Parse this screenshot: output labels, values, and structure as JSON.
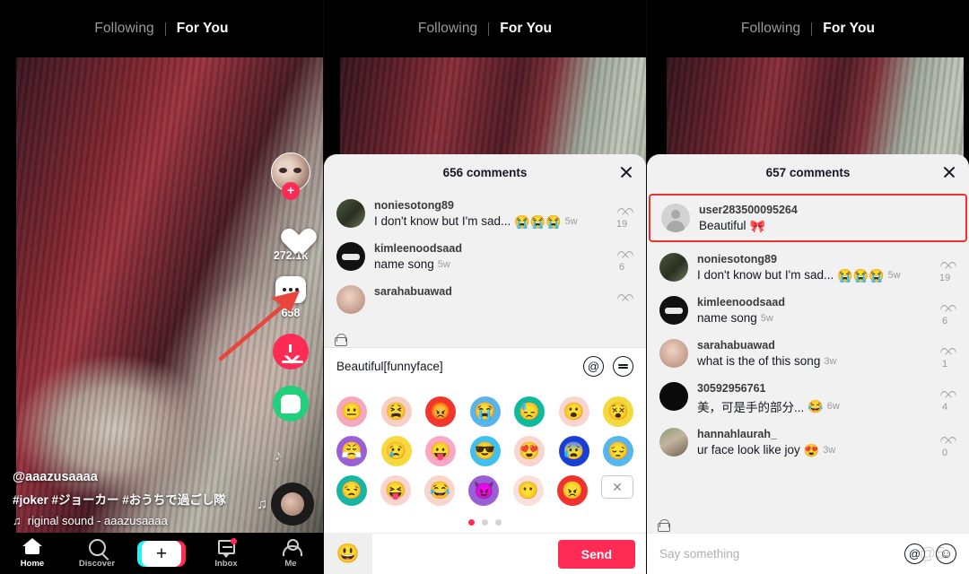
{
  "header": {
    "following_label": "Following",
    "for_you_label": "For You"
  },
  "panel1": {
    "rail": {
      "like_count": "272.1k",
      "comment_count": "658",
      "avatar_plus": "+"
    },
    "caption": {
      "username": "@aaazusaaaa",
      "hashtags": "#joker #ジョーカー #おうちで過ごし隊",
      "sound": "riginal sound - aaazusaaaa",
      "music_note": "♫"
    },
    "nav": [
      {
        "label": "Home",
        "icon": "home-icon"
      },
      {
        "label": "Discover",
        "icon": "search-icon"
      },
      {
        "label": "",
        "icon": "plus-icon"
      },
      {
        "label": "Inbox",
        "icon": "inbox-icon"
      },
      {
        "label": "Me",
        "icon": "person-icon"
      }
    ]
  },
  "panel2": {
    "sheet_title": "656 comments",
    "comments": [
      {
        "user": "noniesotong89",
        "text": "I don't know but I'm sad...",
        "emoji": "😭😭😭",
        "time": "5w",
        "likes": "19",
        "avatar": "av-grassy"
      },
      {
        "user": "kimleenoodsaad",
        "text": "name song",
        "emoji": "",
        "time": "5w",
        "likes": "6",
        "avatar": "av-dark"
      },
      {
        "user": "sarahabuawad",
        "text": "",
        "emoji": "",
        "time": "",
        "likes": "",
        "avatar": "av-skin"
      }
    ],
    "input_value": "Beautiful[funnyface]",
    "mention_icon": "@",
    "keyboard_icon": "keyboard-icon",
    "emoji_rows": [
      [
        {
          "char": "😐",
          "color": "#f4a8bd"
        },
        {
          "char": "😫",
          "color": "#f8cfc4"
        },
        {
          "char": "😡",
          "color": "#f0362e"
        },
        {
          "char": "😭",
          "color": "#5ab4e8"
        },
        {
          "char": "😓",
          "color": "#10b99b"
        },
        {
          "char": "😮",
          "color": "#f9d5cd"
        },
        {
          "char": "😵",
          "color": "#f2d93c"
        }
      ],
      [
        {
          "char": "😤",
          "color": "#9a5fd6"
        },
        {
          "char": "😢",
          "color": "#f5d93e"
        },
        {
          "char": "😛",
          "color": "#f8a7c8"
        },
        {
          "char": "😎",
          "color": "#3fc0ef"
        },
        {
          "char": "😍",
          "color": "#f9d5cd"
        },
        {
          "char": "😰",
          "color": "#1a3fd4"
        },
        {
          "char": "😔",
          "color": "#56b6ee"
        }
      ],
      [
        {
          "char": "😒",
          "color": "#18b5a2"
        },
        {
          "char": "😝",
          "color": "#f9d5cd"
        },
        {
          "char": "😂",
          "color": "#f9d5cd"
        },
        {
          "char": "😈",
          "color": "#9a5fd6"
        },
        {
          "char": "😶",
          "color": "#fae0da"
        },
        {
          "char": "😠",
          "color": "#f0322f"
        }
      ]
    ],
    "backspace_icon": "backspace-icon",
    "page_dots": 3,
    "active_dot": 0,
    "send_label": "Send",
    "send_emoji": "😃"
  },
  "panel3": {
    "sheet_title": "657 comments",
    "highlighted": {
      "user": "user283500095264",
      "text": "Beautiful",
      "emoji": "🎀",
      "avatar": "av-gray"
    },
    "comments": [
      {
        "user": "noniesotong89",
        "text": "I don't know but I'm sad...",
        "emoji": "😭😭😭",
        "time": "5w",
        "likes": "19",
        "avatar": "av-grassy"
      },
      {
        "user": "kimleenoodsaad",
        "text": "name song",
        "emoji": "",
        "time": "5w",
        "likes": "6",
        "avatar": "av-dark"
      },
      {
        "user": "sarahabuawad",
        "text": "what is the of this song",
        "emoji": "",
        "time": "3w",
        "likes": "1",
        "avatar": "av-skin"
      },
      {
        "user": "30592956761",
        "text": "美，可是手的部分...",
        "emoji": "😂",
        "time": "6w",
        "likes": "4",
        "avatar": "av-black"
      },
      {
        "user": "hannahlaurah_",
        "text": "ur face look like joy",
        "emoji": "😍",
        "time": "3w",
        "likes": "0",
        "avatar": "av-photo"
      }
    ],
    "input_placeholder": "Say something",
    "watermark": "@5",
    "mention_icon": "@",
    "emoji_icon": "😀"
  },
  "colors": {
    "accent_red": "#fe2c55",
    "highlight_border": "#f0322f",
    "share_green": "#21d07a",
    "sheet_bg": "#f1f1f1"
  }
}
